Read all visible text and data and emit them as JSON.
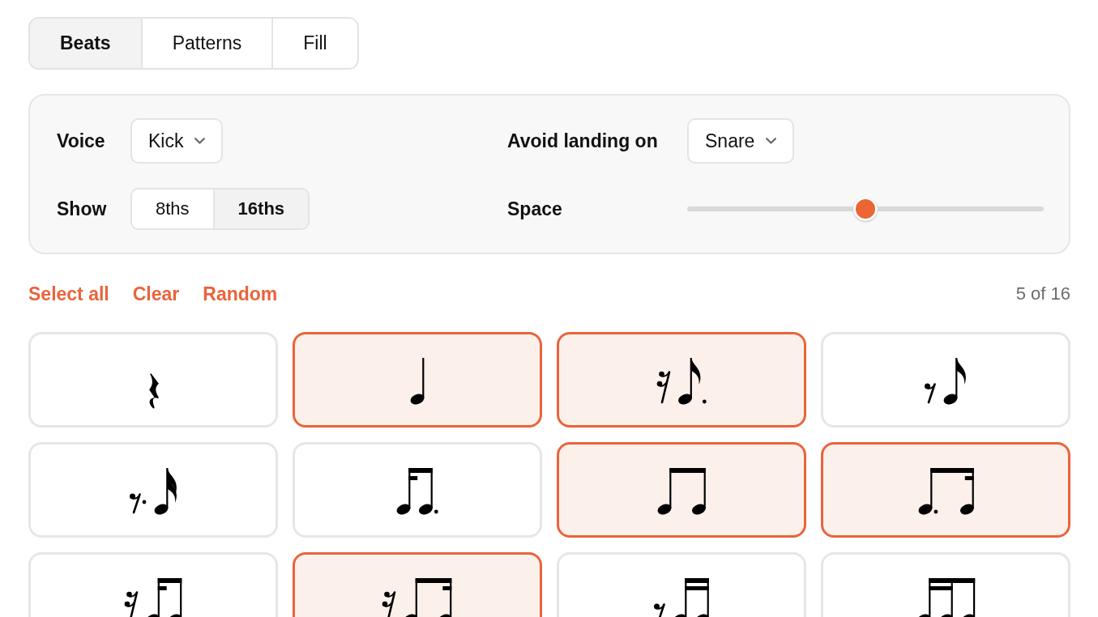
{
  "tabs": [
    {
      "label": "Beats",
      "selected": true
    },
    {
      "label": "Patterns",
      "selected": false
    },
    {
      "label": "Fill",
      "selected": false
    }
  ],
  "settings": {
    "voice": {
      "label": "Voice",
      "value": "Kick"
    },
    "avoid_landing": {
      "label": "Avoid landing on",
      "value": "Snare"
    },
    "show": {
      "label": "Show",
      "options": [
        {
          "label": "8ths",
          "selected": false
        },
        {
          "label": "16ths",
          "selected": true
        }
      ]
    },
    "space": {
      "label": "Space",
      "level": 0.5
    }
  },
  "actions": [
    "Select all",
    "Clear",
    "Random"
  ],
  "count": "5 of 16",
  "cards": [
    {
      "kind": "r4",
      "selected": false
    },
    {
      "kind": "n4",
      "selected": true
    },
    {
      "kind": "r16n8d",
      "selected": true
    },
    {
      "kind": "r8n8",
      "selected": false
    },
    {
      "kind": "r8dn16",
      "selected": false
    },
    {
      "kind": "n16n8d",
      "selected": false
    },
    {
      "kind": "n8n8",
      "selected": true
    },
    {
      "kind": "n8dn16",
      "selected": true
    },
    {
      "kind": "r16n16n8",
      "selected": false
    },
    {
      "kind": "r16n8n16",
      "selected": true
    },
    {
      "kind": "r8n16n16",
      "selected": false
    },
    {
      "kind": "n16n16n8",
      "selected": false
    }
  ]
}
